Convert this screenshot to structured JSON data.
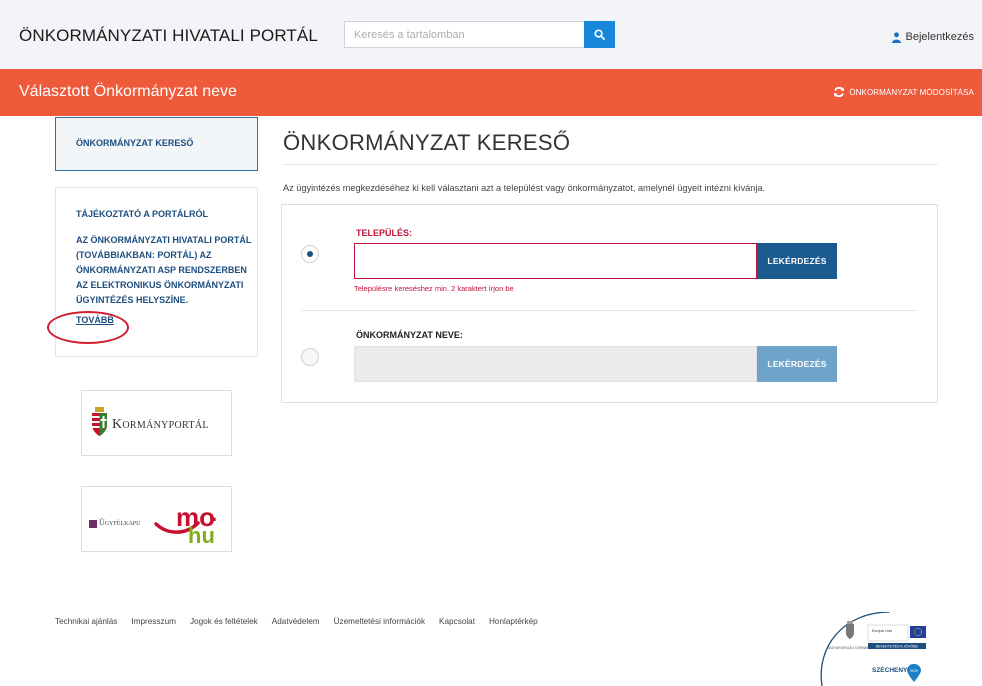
{
  "header": {
    "site_title": "ÖNKORMÁNYZATI HIVATALI PORTÁL",
    "search_placeholder": "Keresés a tartalomban",
    "login_label": "Bejelentkezés"
  },
  "bar": {
    "selected_name": "Választott Önkormányzat neve",
    "change_label": "ÖNKORMÁNYZAT MÓDOSÍTÁSA"
  },
  "sidebar": {
    "active_item": "ÖNKORMÁNYZAT KERESŐ",
    "info_title": "TÁJÉKOZTATÓ A PORTÁLRÓL",
    "info_text": "AZ ÖNKORMÁNYZATI HIVATALI PORTÁL (TOVÁBBIAKBAN: PORTÁL) AZ ÖNKORMÁNYZATI ASP RENDSZERBEN AZ ELEKTRONIKUS ÖNKORMÁNYZATI ÜGYINTÉZÉS HELYSZÍNE.",
    "more_link": "TOVÁBB",
    "logo1_text": "Kormányportál",
    "logo2_text": "Ügyfélkapu",
    "logo2_mark": "mo.hu"
  },
  "main": {
    "title": "ÖNKORMÁNYZAT KERESŐ",
    "intro": "Az ügyintézés megkezdéséhez ki kell választani azt a települést vagy önkormányzatot, amelynél ügyeit intézni kívánja.",
    "field1_label": "TELEPÜLÉS:",
    "field1_button": "LEKÉRDEZÉS",
    "field1_error": "Településre kereséshez min. 2 karaktert írjon be",
    "field2_label": "ÖNKORMÁNYZAT NEVE:",
    "field2_button": "LEKÉRDEZÉS"
  },
  "footer": {
    "links": [
      "Technikai ajánlás",
      "Impresszum",
      "Jogok és feltételek",
      "Adatvédelem",
      "Üzemeltetési információk",
      "Kapcsolat",
      "Honlaptérkép"
    ],
    "badge_brand": "SZÉCHENYI",
    "badge_year": "2020",
    "badge_ministry": "MAGYARORSZÁG KORMÁNYA",
    "badge_eu": "Európai Unió",
    "badge_slogan": "BEFEKTETÉS A JÖVŐBE"
  },
  "colors": {
    "accent_orange": "#ef5a3b",
    "primary_blue": "#1b5b8f",
    "search_blue": "#1687d9",
    "error_red": "#c0143c"
  }
}
